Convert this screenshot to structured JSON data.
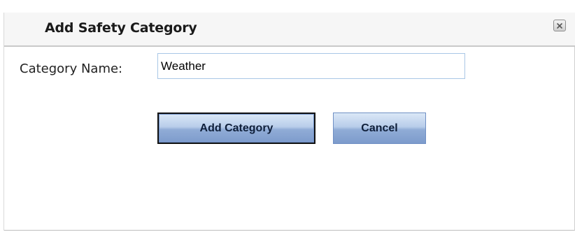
{
  "dialog": {
    "title": "Add Safety Category",
    "close_icon": "close-icon"
  },
  "form": {
    "category_label": "Category Name:",
    "category_value": "Weather"
  },
  "buttons": {
    "add_label": "Add Category",
    "cancel_label": "Cancel"
  }
}
